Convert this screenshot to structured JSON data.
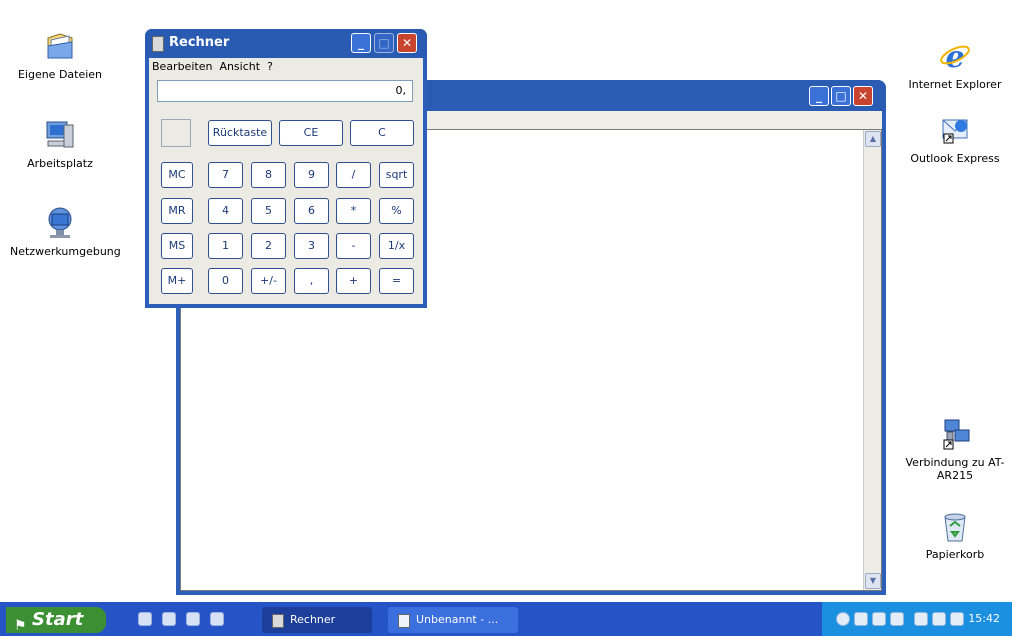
{
  "desktop": {
    "icons_left": [
      {
        "label": "Eigene Dateien",
        "icon": "my-documents-icon"
      },
      {
        "label": "Arbeitsplatz",
        "icon": "my-computer-icon"
      },
      {
        "label": "Netzwerkumgebung",
        "icon": "network-places-icon"
      }
    ],
    "icons_right": [
      {
        "label": "Internet Explorer",
        "icon": "internet-explorer-icon"
      },
      {
        "label": "Outlook Express",
        "icon": "outlook-express-icon"
      },
      {
        "label": "Verbindung zu AT-AR215",
        "icon": "network-connection-icon"
      },
      {
        "label": "Papierkorb",
        "icon": "recycle-bin-icon"
      }
    ]
  },
  "calculator": {
    "title": "Rechner",
    "menu": [
      "Bearbeiten",
      "Ansicht",
      "?"
    ],
    "display": "0,",
    "buttons": {
      "backspace": "Rücktaste",
      "ce": "CE",
      "c": "C",
      "mc": "MC",
      "mr": "MR",
      "ms": "MS",
      "mplus": "M+",
      "row1": [
        "7",
        "8",
        "9",
        "/",
        "sqrt"
      ],
      "row2": [
        "4",
        "5",
        "6",
        "*",
        "%"
      ],
      "row3": [
        "1",
        "2",
        "3",
        "-",
        "1/x"
      ],
      "row4": [
        "0",
        "+/-",
        ",",
        "+",
        "="
      ]
    }
  },
  "taskbar": {
    "start": "Start",
    "tasks": [
      "Rechner",
      "Unbenannt - ..."
    ],
    "clock": "15:42"
  },
  "colors": {
    "desktop": "#ffffff",
    "window_frame": "#2b5fb8",
    "taskbar": "#2554c7",
    "start_button": "#3c8f33",
    "tray": "#1b8fe0"
  }
}
